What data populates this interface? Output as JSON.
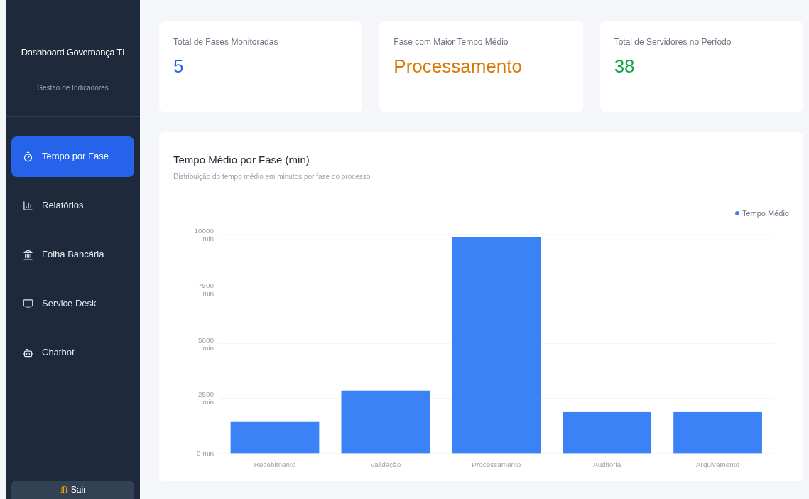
{
  "sidebar": {
    "title": "Dashboard Governança TI",
    "subtitle": "Gestão de Indicadores",
    "items": [
      {
        "label": "Tempo por Fase",
        "kind": "timer",
        "selected": true
      },
      {
        "label": "Relatórios",
        "kind": "chart",
        "selected": false
      },
      {
        "label": "Folha Bancária",
        "kind": "bank",
        "selected": false
      },
      {
        "label": "Service Desk",
        "kind": "monitor",
        "selected": false
      },
      {
        "label": "Chatbot",
        "kind": "bot",
        "selected": false
      }
    ],
    "logout": {
      "label": "Sair"
    }
  },
  "cards": [
    {
      "label": "Total de Fases Monitoradas",
      "value": "5",
      "color": "#2563eb"
    },
    {
      "label": "Fase com Maior Tempo Médio",
      "value": "Processamento",
      "color": "#d97706"
    },
    {
      "label": "Total de Servidores no Período",
      "value": "38",
      "color": "#16a34a"
    }
  ],
  "chart_panel": {
    "title": "Tempo Médio por Fase (min)",
    "subtitle": "Distribuição do tempo médio em minutos por fase do processo",
    "chart_data": {
      "type": "bar",
      "categories": [
        "Recebimento",
        "Validação",
        "Processamento",
        "Auditoria",
        "Arquivamento"
      ],
      "series": [
        {
          "name": "Tempo Médio",
          "color": "#3b82f6",
          "values": [
            1450,
            2850,
            9900,
            1900,
            1900
          ]
        }
      ],
      "ylim": [
        0,
        10000
      ],
      "grid": true,
      "yticks": [
        {
          "value": 0,
          "label": "0 min"
        },
        {
          "value": 2500,
          "label": "2500 min"
        },
        {
          "value": 5000,
          "label": "5000 min"
        },
        {
          "value": 7500,
          "label": "7500 min"
        },
        {
          "value": 10000,
          "label": "10000 min"
        }
      ]
    }
  }
}
